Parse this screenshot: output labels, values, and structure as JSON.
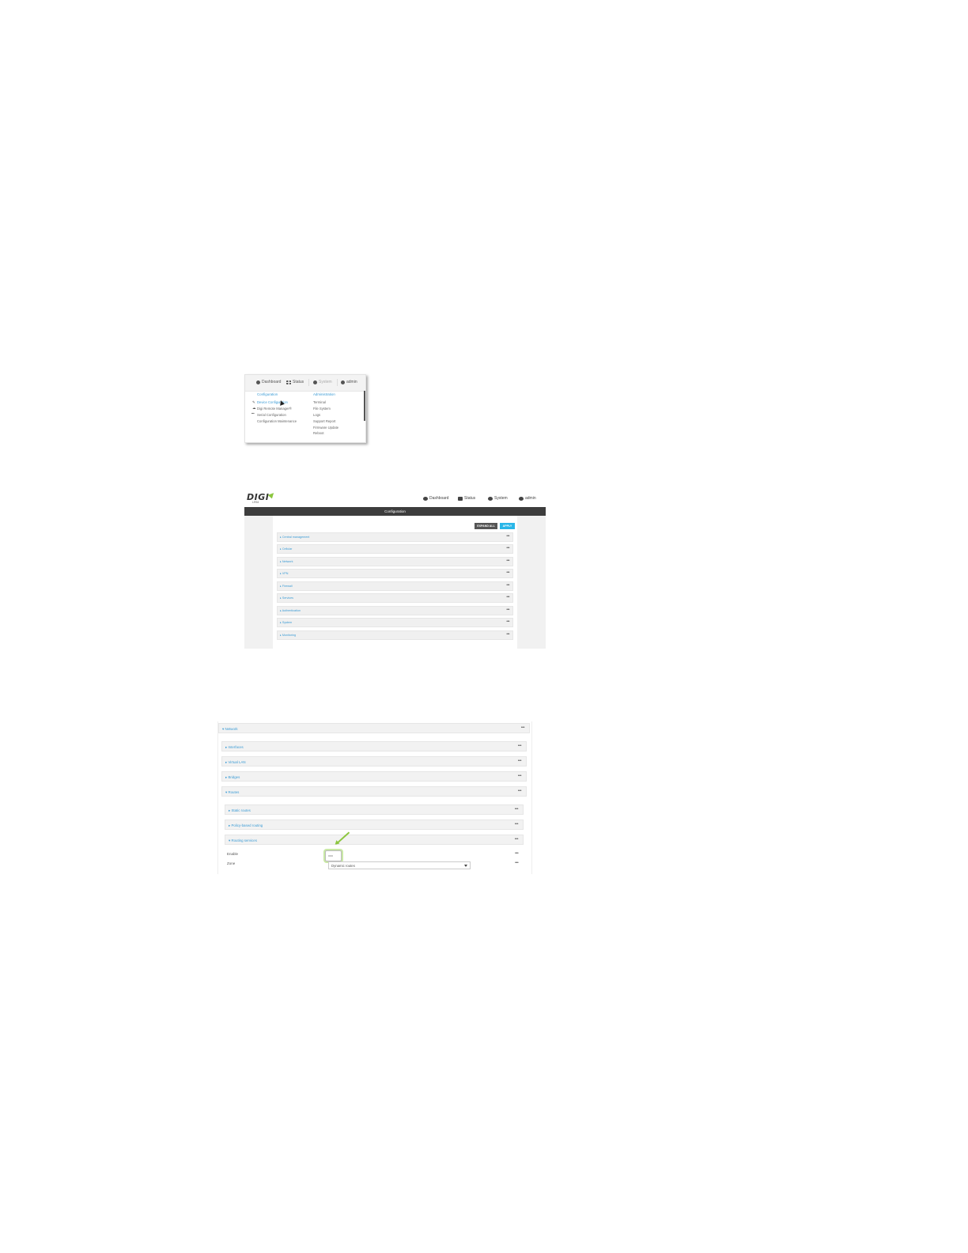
{
  "menu_screenshot": {
    "nav": [
      "Dashboard",
      "Status",
      "System",
      "admin"
    ],
    "configuration": {
      "heading": "Configuration",
      "items": [
        "Device Configuration",
        "Digi Remote Manager®",
        "Serial Configuration",
        "Configuration Maintenance"
      ]
    },
    "administration": {
      "heading": "Administration",
      "items": [
        "Terminal",
        "File System",
        "Logs",
        "Support Report",
        "Firmware Update",
        "Reboot"
      ]
    }
  },
  "config_screenshot": {
    "logo": "DIGI",
    "logo_sub": "LR54",
    "nav": [
      "Dashboard",
      "Status",
      "System",
      "admin"
    ],
    "title": "Configuration",
    "buttons": {
      "expand_all": "EXPAND ALL",
      "apply": "APPLY"
    },
    "sections": [
      "Central management",
      "Cellular",
      "Network",
      "VPN",
      "Firewall",
      "Services",
      "Authentication",
      "System",
      "Monitoring"
    ]
  },
  "network_screenshot": {
    "network": "Network",
    "subsections": [
      "Interfaces",
      "Virtual LAN",
      "Bridges",
      "Routes"
    ],
    "routes_children": [
      "Static routes",
      "Policy-based routing",
      "Routing services"
    ],
    "fields": {
      "enable_label": "Enable",
      "zone_label": "Zone",
      "zone_value": "Dynamic routes"
    }
  },
  "colors": {
    "link": "#3a9bd5",
    "accent_green": "#8cc63f",
    "apply_blue": "#29b6e8",
    "titlebar": "#3d3d3d"
  }
}
